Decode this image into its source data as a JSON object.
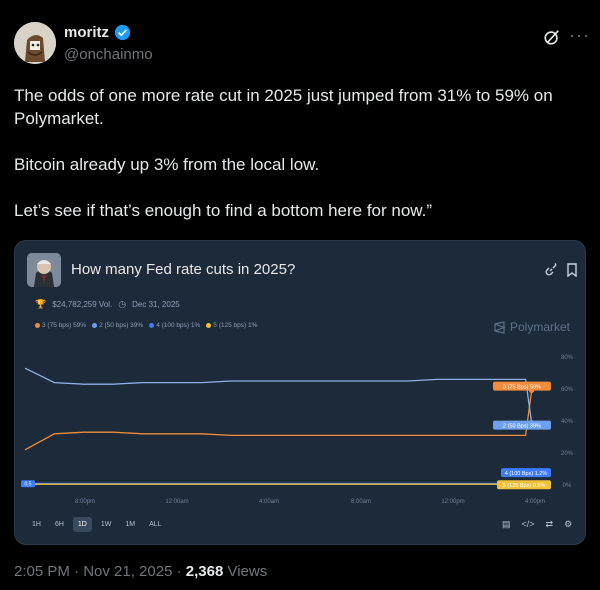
{
  "author": {
    "display_name": "moritz",
    "handle": "@onchainmo"
  },
  "tweet": {
    "paragraphs": [
      "The odds of one more rate cut in 2025 just jumped from 31% to 59% on Polymarket.",
      "Bitcoin already up 3% from the local low.",
      "Let’s see if that’s enough to find a bottom here for now.”"
    ]
  },
  "card": {
    "title": "How many Fed rate cuts in 2025?",
    "volume": "$24,782,259 Vol.",
    "end_date": "Dec 31, 2025",
    "brand": "Polymarket",
    "legend": [
      {
        "label": "3 (75 bps) 59%",
        "color": "#f08c3a"
      },
      {
        "label": "2 (50 bps) 39%",
        "color": "#6fa0f0"
      },
      {
        "label": "4 (100 bps) 1%",
        "color": "#3f7bff"
      },
      {
        "label": "5 (125 bps) 1%",
        "color": "#f0c23a"
      }
    ],
    "ranges": [
      "1H",
      "6H",
      "1D",
      "1W",
      "1M",
      "ALL"
    ],
    "active_range": "1D"
  },
  "chart_data": {
    "type": "line",
    "x_ticks": [
      "8:00pm",
      "12:00am",
      "4:00am",
      "8:00am",
      "12:00pm",
      "4:00pm"
    ],
    "y_ticks": [
      "80%",
      "60%",
      "40%",
      "20%",
      "0%"
    ],
    "ylim": [
      0,
      80
    ],
    "x": [
      0,
      2,
      4,
      6,
      8,
      10,
      12,
      14,
      16,
      18,
      20,
      22,
      24
    ],
    "series": [
      {
        "name": "3 (75 Bps) 59%",
        "color": "#f08c3a",
        "values": [
          22,
          32,
          33,
          33,
          32,
          32,
          32,
          31,
          31,
          31,
          31,
          31,
          31,
          31,
          31,
          31,
          31,
          31,
          59
        ]
      },
      {
        "name": "2 (50 Bps) 39%",
        "color": "#8fb0e6",
        "values": [
          73,
          64,
          63,
          63,
          64,
          64,
          64,
          65,
          65,
          65,
          65,
          65,
          65,
          65,
          66,
          66,
          66,
          66,
          39
        ]
      },
      {
        "name": "4 (100 Bps) 1.2%",
        "color": "#3f7bff",
        "values": [
          1,
          1,
          1,
          1,
          1,
          1,
          1,
          1,
          1,
          1,
          1,
          1,
          1,
          1,
          1,
          1,
          1,
          1,
          1.2
        ]
      },
      {
        "name": "5 (125 Bps) 0.5%",
        "color": "#f0c23a",
        "values": [
          0.5,
          0.5,
          0.5,
          0.5,
          0.5,
          0.5,
          0.5,
          0.5,
          0.5,
          0.5,
          0.5,
          0.5,
          0.5,
          0.5,
          0.5,
          0.5,
          0.5,
          0.5,
          0.5
        ]
      }
    ],
    "end_labels": [
      "3 (75 Bps) 59%",
      "2 (50 Bps) 39%",
      "4 (100 Bps) 1.2%",
      "5 (125 Bps) 0.5%"
    ],
    "start_label": "0.5",
    "grid": false
  },
  "footer": {
    "time": "2:05 PM · Nov 21, 2025 · ",
    "views_count": "2,368",
    "views_label": " Views"
  }
}
